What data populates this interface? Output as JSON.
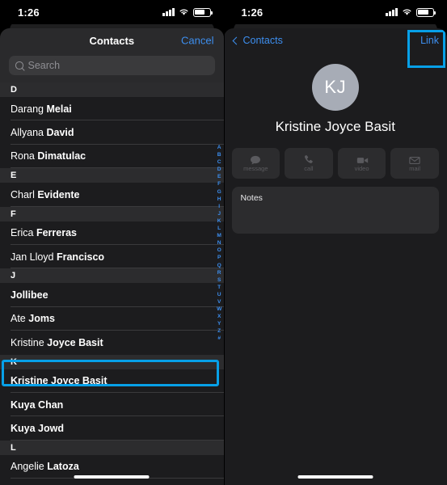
{
  "status_bar": {
    "time": "1:26",
    "icons": [
      "cellular-signal-icon",
      "wifi-icon",
      "battery-icon"
    ]
  },
  "colors": {
    "accent_blue": "#3d8ff0",
    "highlight_cyan": "#07a0e8",
    "sheet_bg": "#1c1c1e",
    "section_bg": "#2c2c2e",
    "avatar_bg": "#a7acb6"
  },
  "left_pane": {
    "nav": {
      "title": "Contacts",
      "cancel_label": "Cancel"
    },
    "search": {
      "placeholder": "Search",
      "value": "",
      "icon": "search-icon"
    },
    "index_letters": [
      "A",
      "B",
      "C",
      "D",
      "E",
      "F",
      "G",
      "H",
      "I",
      "J",
      "K",
      "L",
      "M",
      "N",
      "O",
      "P",
      "Q",
      "R",
      "S",
      "T",
      "U",
      "V",
      "W",
      "X",
      "Y",
      "Z",
      "#"
    ],
    "sections": [
      {
        "letter": "D",
        "contacts": [
          {
            "first": "Darang",
            "last": "Melai"
          },
          {
            "first": "Allyana",
            "last": "David"
          },
          {
            "first": "Rona",
            "last": "Dimatulac"
          }
        ]
      },
      {
        "letter": "E",
        "contacts": [
          {
            "first": "Charl",
            "last": "Evidente"
          }
        ]
      },
      {
        "letter": "F",
        "contacts": [
          {
            "first": "Erica",
            "last": "Ferreras"
          },
          {
            "first": "Jan Lloyd",
            "last": "Francisco"
          }
        ]
      },
      {
        "letter": "J",
        "contacts": [
          {
            "first": "",
            "last": "Jollibee"
          },
          {
            "first": "Ate",
            "last": "Joms"
          },
          {
            "first": "Kristine ",
            "last": "Joyce Basit",
            "selected": true
          }
        ]
      },
      {
        "letter": "K",
        "contacts": [
          {
            "first": "",
            "last": "Kristine Joyce Basit"
          },
          {
            "first": "",
            "last": "Kuya Chan"
          },
          {
            "first": "",
            "last": "Kuya Jowd"
          }
        ]
      },
      {
        "letter": "L",
        "contacts": [
          {
            "first": "Angelie",
            "last": "Latoza"
          }
        ]
      }
    ]
  },
  "right_pane": {
    "nav": {
      "back_label": "Contacts",
      "back_icon": "chevron-left-icon",
      "link_label": "Link",
      "link_highlighted": true
    },
    "contact": {
      "initials": "KJ",
      "name": "Kristine  Joyce Basit"
    },
    "actions": [
      {
        "label": "message",
        "icon": "message-bubble-icon"
      },
      {
        "label": "call",
        "icon": "phone-icon"
      },
      {
        "label": "video",
        "icon": "video-camera-icon"
      },
      {
        "label": "mail",
        "icon": "envelope-icon"
      }
    ],
    "notes": {
      "label": "Notes",
      "value": ""
    }
  }
}
